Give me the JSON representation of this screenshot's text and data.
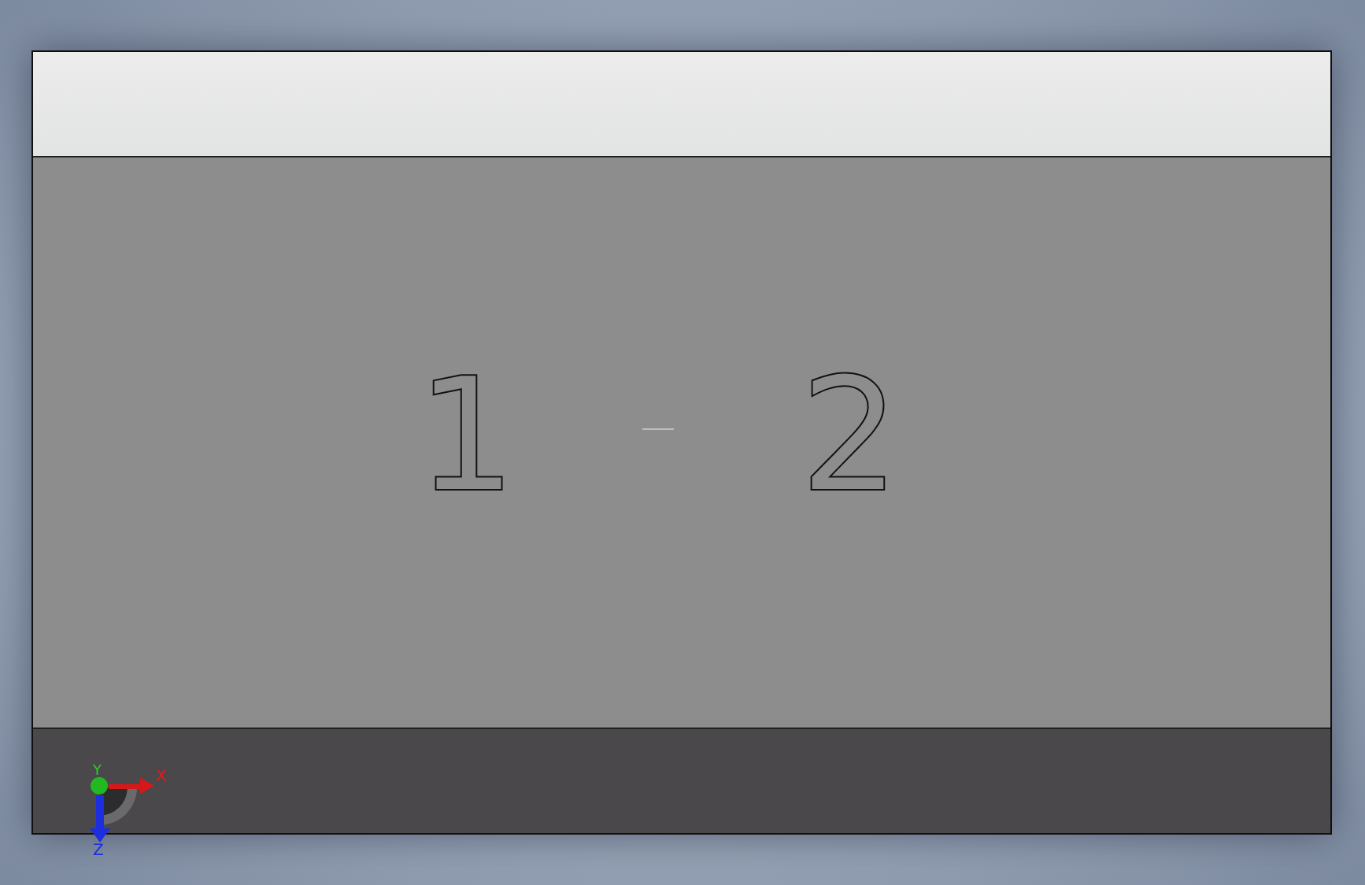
{
  "viewport": {
    "model_text": [
      {
        "text": "1"
      },
      {
        "text": "2"
      }
    ],
    "triad": {
      "x_label": "X",
      "y_label": "Y",
      "z_label": "Z"
    }
  }
}
